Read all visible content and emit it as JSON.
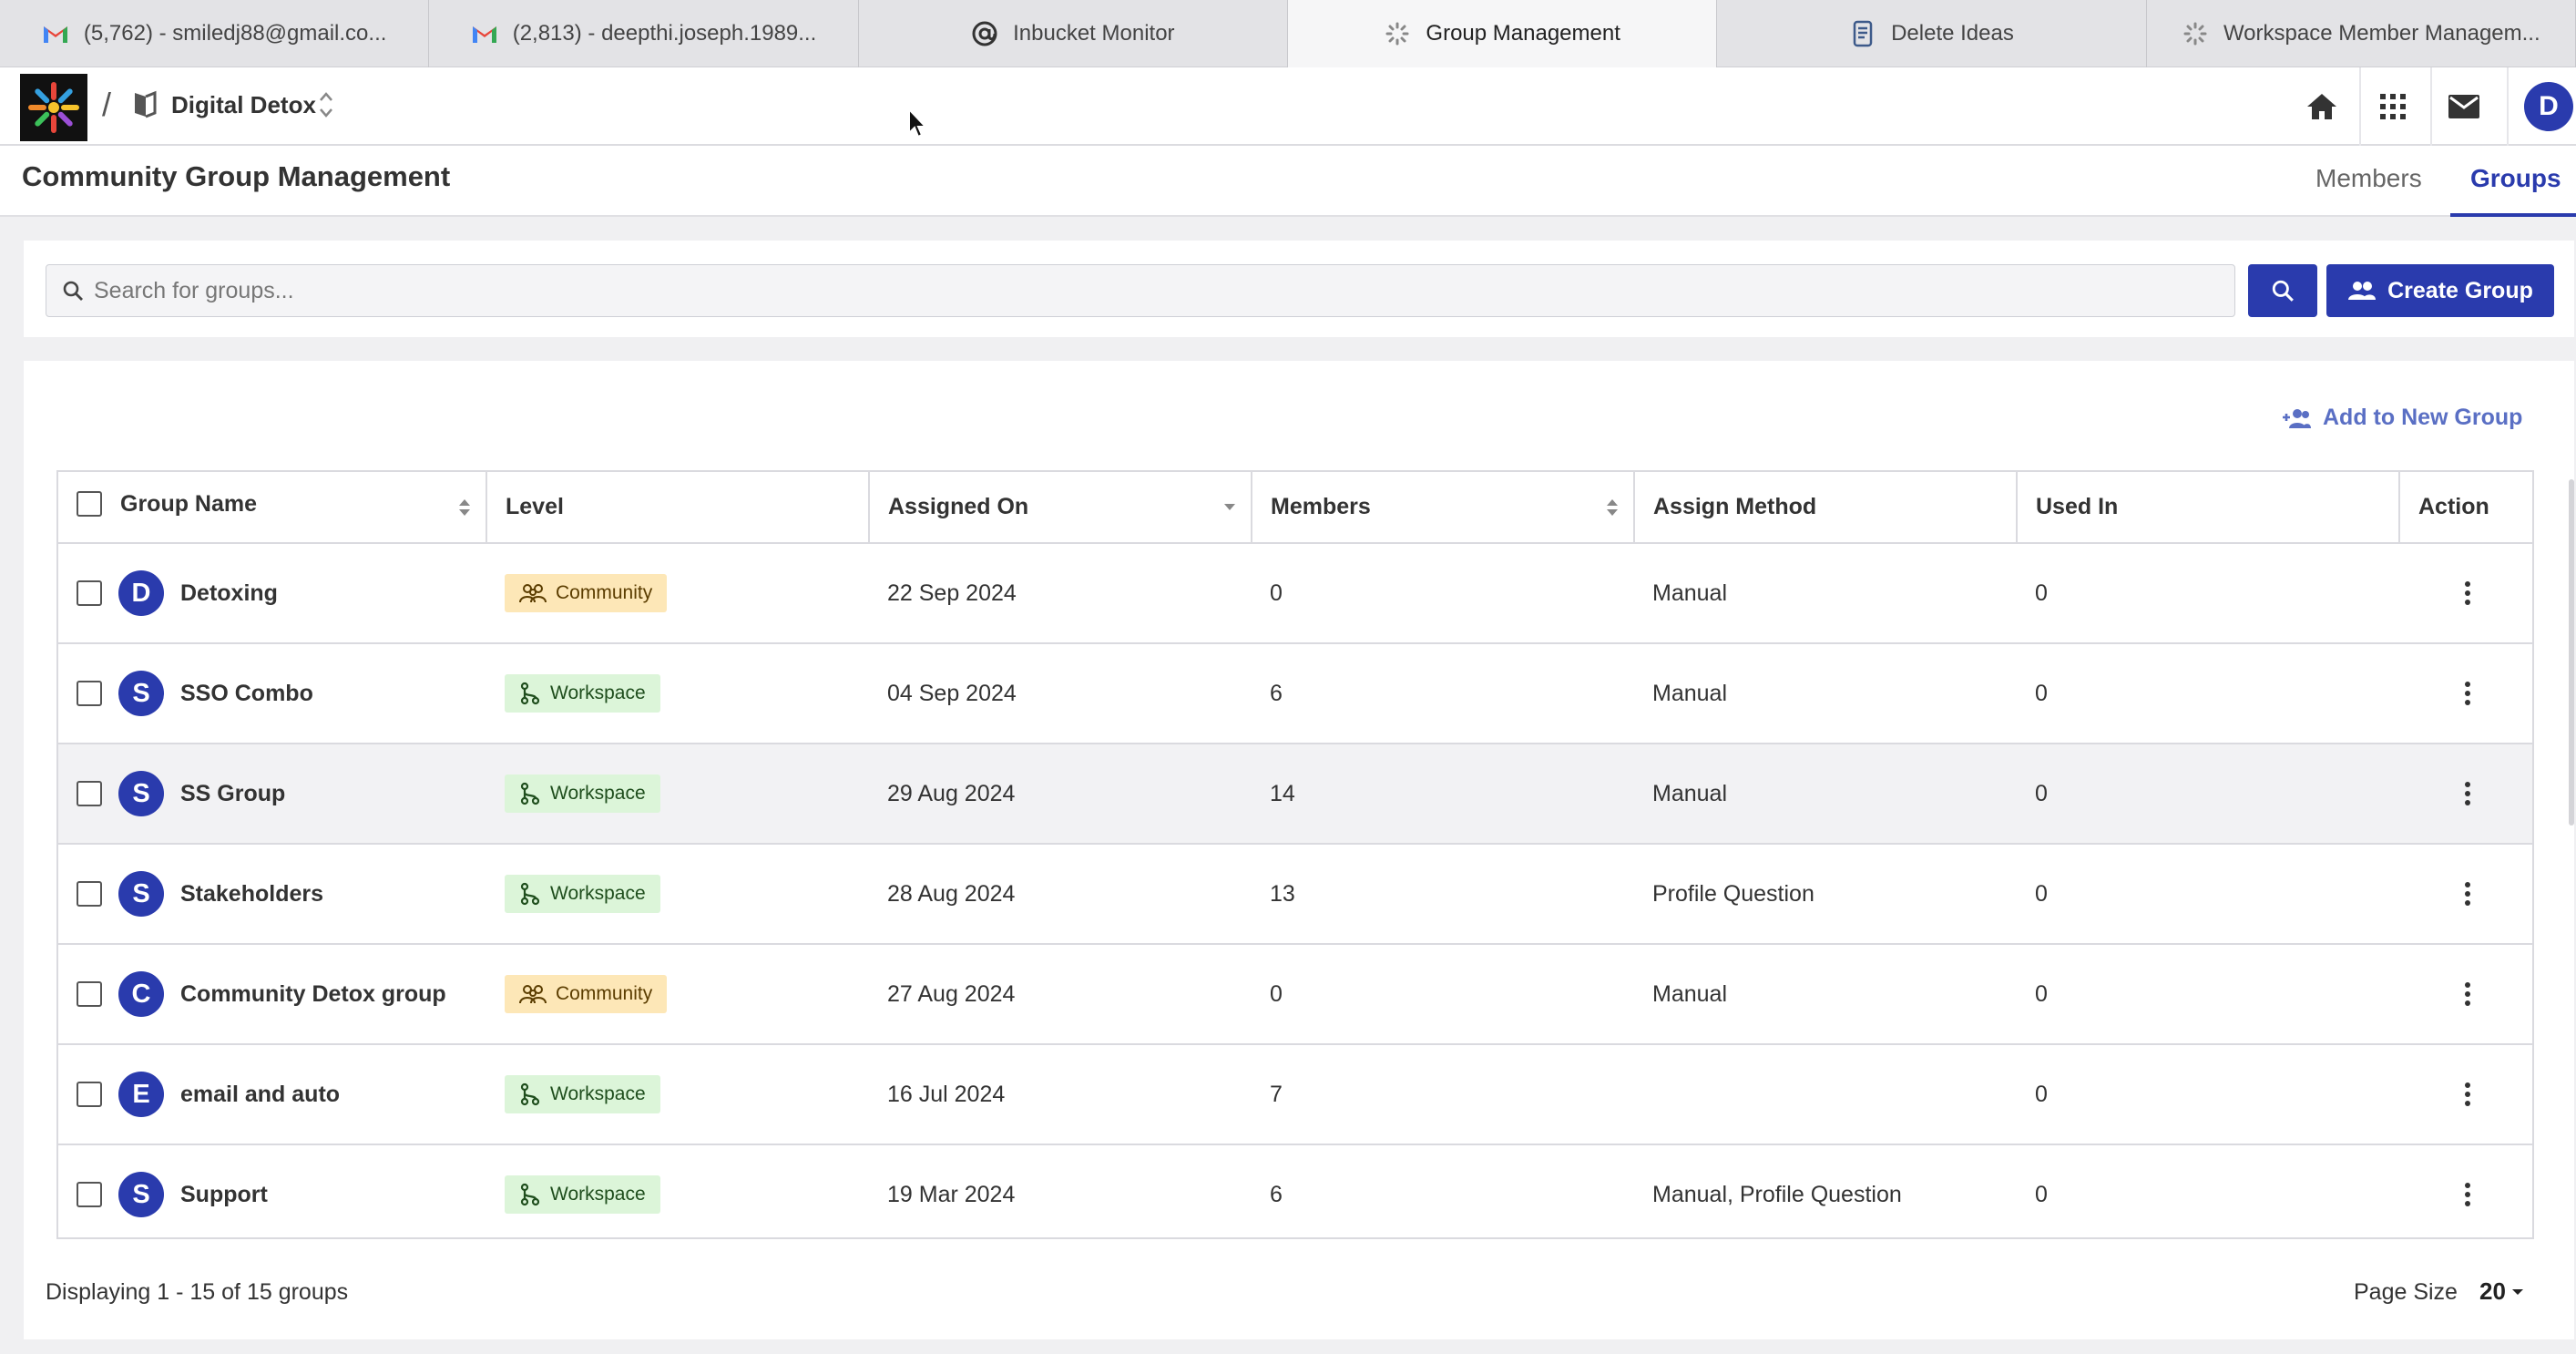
{
  "browser": {
    "tabs": [
      {
        "title": "(5,762) - smiledj88@gmail.co...",
        "icon": "gmail-icon"
      },
      {
        "title": "(2,813) - deepthi.joseph.1989...",
        "icon": "gmail-icon"
      },
      {
        "title": "Inbucket Monitor",
        "icon": "at-sign-icon"
      },
      {
        "title": "Group Management",
        "icon": "loading-spinner-icon",
        "active": true
      },
      {
        "title": "Delete Ideas",
        "icon": "document-icon"
      },
      {
        "title": "Workspace Member Managem...",
        "icon": "loading-spinner-icon"
      }
    ]
  },
  "header": {
    "separator": "/",
    "workspace_name": "Digital Detox",
    "avatar_initial": "D",
    "icons": [
      "home-icon",
      "apps-grid-icon",
      "mail-icon"
    ]
  },
  "page": {
    "title": "Community Group Management",
    "tabs": [
      {
        "label": "Members",
        "active": false
      },
      {
        "label": "Groups",
        "active": true
      }
    ]
  },
  "search": {
    "placeholder": "Search for groups...",
    "value": "",
    "create_label": "Create Group"
  },
  "toolbar": {
    "add_new_label": "Add to New Group"
  },
  "table": {
    "columns": [
      "Group Name",
      "Level",
      "Assigned On",
      "Members",
      "Assign Method",
      "Used In",
      "Action"
    ],
    "rows": [
      {
        "initial": "D",
        "name": "Detoxing",
        "level": "Community",
        "assigned_on": "22 Sep 2024",
        "members": "0",
        "assign_method": "Manual",
        "used_in": "0"
      },
      {
        "initial": "S",
        "name": "SSO Combo",
        "level": "Workspace",
        "assigned_on": "04 Sep 2024",
        "members": "6",
        "assign_method": "Manual",
        "used_in": "0"
      },
      {
        "initial": "S",
        "name": "SS Group",
        "level": "Workspace",
        "assigned_on": "29 Aug 2024",
        "members": "14",
        "assign_method": "Manual",
        "used_in": "0",
        "highlighted": true
      },
      {
        "initial": "S",
        "name": "Stakeholders",
        "level": "Workspace",
        "assigned_on": "28 Aug 2024",
        "members": "13",
        "assign_method": "Profile Question",
        "used_in": "0"
      },
      {
        "initial": "C",
        "name": "Community Detox group",
        "level": "Community",
        "assigned_on": "27 Aug 2024",
        "members": "0",
        "assign_method": "Manual",
        "used_in": "0"
      },
      {
        "initial": "E",
        "name": "email and auto",
        "level": "Workspace",
        "assigned_on": "16 Jul 2024",
        "members": "7",
        "assign_method": "",
        "used_in": "0"
      },
      {
        "initial": "S",
        "name": "Support",
        "level": "Workspace",
        "assigned_on": "19 Mar 2024",
        "members": "6",
        "assign_method": "Manual, Profile Question",
        "used_in": "0"
      }
    ]
  },
  "footer": {
    "displaying": "Displaying 1 - 15 of 15 groups",
    "page_size_label": "Page Size",
    "page_size_value": "20"
  },
  "colors": {
    "primary": "#2a3bad",
    "community_badge_bg": "#fde7b7",
    "workspace_badge_bg": "#dcf5d9",
    "link": "#5a6fc4"
  }
}
